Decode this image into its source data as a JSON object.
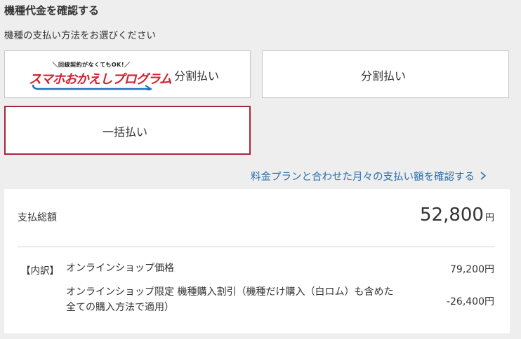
{
  "header": {
    "title": "機種代金を確認する",
    "subtitle": "機種の支払い方法をお選びください"
  },
  "payment_options": {
    "option1": {
      "logo_top": "＼回線契約がなくてもOK!／",
      "logo_main": "スマホおかえしプログラム",
      "label": "分割払い"
    },
    "option2": {
      "label": "分割払い"
    },
    "option3": {
      "label": "一括払い",
      "selected": true
    }
  },
  "plan_link": {
    "label": "料金プランと合わせた月々の支払い額を確認する"
  },
  "summary": {
    "total_label": "支払総額",
    "total_amount": "52,800",
    "currency": "円",
    "breakdown_label": "【内訳】",
    "rows": [
      {
        "name": "オンラインショップ価格",
        "value": "79,200円"
      },
      {
        "name_line1": "オンラインショップ限定 機種購入割引（機種だけ購入（白ロム）も含めた",
        "name_line2": "全ての購入方法で適用）",
        "value": "-26,400円"
      }
    ]
  },
  "colors": {
    "selected_border": "#a8263d",
    "link": "#2a6fb0",
    "logo_red": "#d2212f",
    "logo_blue": "#1f6fc1"
  }
}
